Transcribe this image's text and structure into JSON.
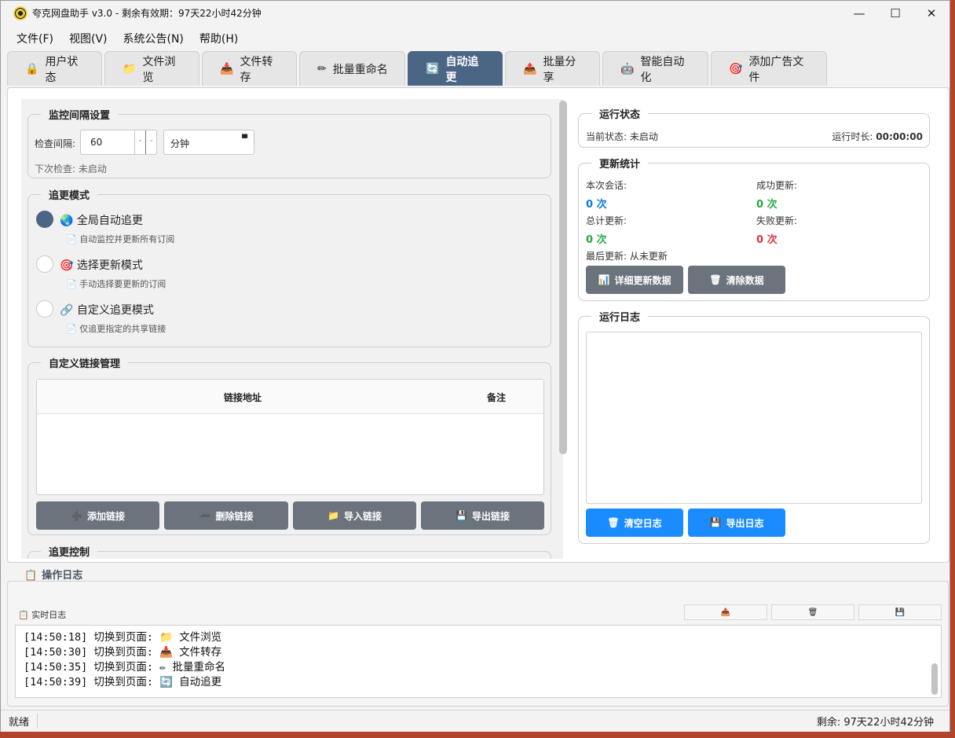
{
  "window": {
    "title": "夸克网盘助手 v3.0 - 剩余有效期：97天22小时42分钟",
    "minimize": "—",
    "maximize": "☐",
    "close": "✕"
  },
  "menu": [
    "文件(F)",
    "视图(V)",
    "系统公告(N)",
    "帮助(H)"
  ],
  "tabs": [
    {
      "icon": "🔒",
      "label": "用户状态"
    },
    {
      "icon": "📁",
      "label": "文件浏览"
    },
    {
      "icon": "📥",
      "label": "文件转存"
    },
    {
      "icon": "✏",
      "label": "批量重命名"
    },
    {
      "icon": "🔄",
      "label": "自动追更"
    },
    {
      "icon": "📤",
      "label": "批量分享"
    },
    {
      "icon": "🤖",
      "label": "智能自动化"
    },
    {
      "icon": "🎯",
      "label": "添加广告文件"
    }
  ],
  "monitor": {
    "title": "监控间隔设置",
    "interval_label": "检查间隔:",
    "interval_value": "60",
    "unit": "分钟",
    "next_check": "下次检查: 未启动"
  },
  "mode": {
    "title": "追更模式",
    "options": [
      {
        "icon": "🌏",
        "label": "全局自动追更",
        "desc": "自动监控并更新所有订阅"
      },
      {
        "icon": "🎯",
        "label": "选择更新模式",
        "desc": "手动选择要更新的订阅"
      },
      {
        "icon": "🔗",
        "label": "自定义追更模式",
        "desc": "仅追更指定的共享链接"
      }
    ]
  },
  "links": {
    "title": "自定义链接管理",
    "col_url": "链接地址",
    "col_note": "备注",
    "add": "添加链接",
    "delete": "删除链接",
    "import": "导入链接",
    "export": "导出链接"
  },
  "next_section": "追更控制",
  "run_status": {
    "title": "运行状态",
    "current": "当前状态: 未启动",
    "duration_label": "运行时长:",
    "duration": "00:00:00"
  },
  "stats": {
    "title": "更新统计",
    "session_label": "本次会话:",
    "session_val": "0 次",
    "success_label": "成功更新:",
    "success_val": "0 次",
    "total_label": "总计更新:",
    "total_val": "0 次",
    "fail_label": "失败更新:",
    "fail_val": "0 次",
    "last": "最后更新: 从未更新",
    "detail_btn": "详细更新数据",
    "clear_btn": "清除数据"
  },
  "runlog": {
    "title": "运行日志",
    "clear_btn": "清空日志",
    "export_btn": "导出日志"
  },
  "oplog": {
    "title": "操作日志",
    "realtime": "实时日志",
    "entries": [
      {
        "time": "[14:50:18]",
        "text": "切换到页面:",
        "icon": "📁",
        "page": "文件浏览"
      },
      {
        "time": "[14:50:30]",
        "text": "切换到页面:",
        "icon": "📥",
        "page": "文件转存"
      },
      {
        "time": "[14:50:35]",
        "text": "切换到页面:",
        "icon": "✏",
        "page": "批量重命名"
      },
      {
        "time": "[14:50:39]",
        "text": "切换到页面:",
        "icon": "🔄",
        "page": "自动追更"
      }
    ]
  },
  "statusbar": {
    "left": "就绪",
    "right": "剩余: 97天22小时42分钟"
  },
  "colors": {
    "accent": "#4b6584",
    "blue": "#1a8cff",
    "green": "#28a745",
    "red": "#dc3545",
    "info": "#0d7bd6"
  }
}
